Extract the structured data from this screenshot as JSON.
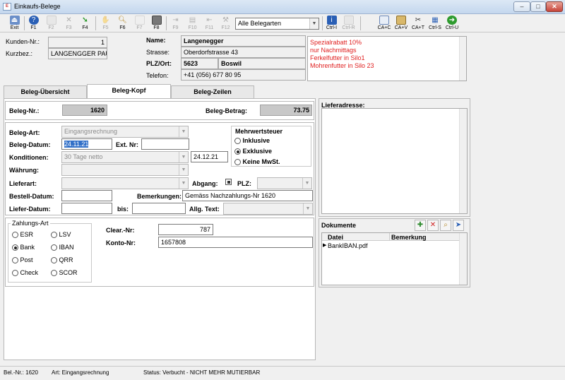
{
  "window": {
    "title": "Einkaufs-Belege",
    "minimize": "–",
    "maximize": "□",
    "close": "✕"
  },
  "toolbar": {
    "buttons": [
      {
        "label": "Exit"
      },
      {
        "label": "F1"
      },
      {
        "label": "F2"
      },
      {
        "label": "F3"
      },
      {
        "label": "F4"
      },
      {
        "label": "F5"
      },
      {
        "label": "F6"
      },
      {
        "label": "F7"
      },
      {
        "label": "F8"
      },
      {
        "label": "F9"
      },
      {
        "label": "F10"
      },
      {
        "label": "F11"
      },
      {
        "label": "F12"
      },
      {
        "label": "Ctrl-I"
      },
      {
        "label": "Ctrl-R"
      },
      {
        "label": "CA+C"
      },
      {
        "label": "CA+V"
      },
      {
        "label": "CA+T"
      },
      {
        "label": "Ctrl-S"
      },
      {
        "label": "Ctrl-U"
      }
    ],
    "belegarten_select": "Alle Belegarten"
  },
  "header": {
    "kunden_nr_label": "Kunden-Nr.:",
    "kunden_nr": "1",
    "kurzbez_label": "Kurzbez.:",
    "kurzbez": "LANGENGGER PAU",
    "name_label": "Name:",
    "name": "Langenegger",
    "strasse_label": "Strasse:",
    "strasse": "Oberdorfstrasse 43",
    "plz_ort_label": "PLZ/Ort:",
    "plz": "5623",
    "ort": "Boswil",
    "telefon_label": "Telefon:",
    "telefon": "+41 (056) 677 80 95",
    "notes": [
      "Spezialrabatt 10%",
      "nur Nachmittags",
      "Ferkelfutter in Silo1",
      "Mohrenfutter in Silo 23"
    ],
    "note_color": "#e02020"
  },
  "tabs": [
    {
      "label": "Beleg-Übersicht"
    },
    {
      "label": "Beleg-Kopf"
    },
    {
      "label": "Beleg-Zeilen"
    }
  ],
  "form": {
    "beleg_nr_label": "Beleg-Nr.:",
    "beleg_nr": "1620",
    "beleg_betrag_label": "Beleg-Betrag:",
    "beleg_betrag": "73.75",
    "beleg_art_label": "Beleg-Art:",
    "beleg_art": "Eingangsrechnung",
    "beleg_datum_label": "Beleg-Datum:",
    "beleg_datum": "24.11.21",
    "ext_nr_label": "Ext. Nr:",
    "ext_nr": "",
    "konditionen_label": "Konditionen:",
    "konditionen": "30 Tage netto",
    "konditionen_datum": "24.12.21",
    "waehrung_label": "Währung:",
    "waehrung": "",
    "lieferart_label": "Lieferart:",
    "lieferart": "",
    "abgang_label": "Abgang:",
    "plz_label": "PLZ:",
    "plz_value": "",
    "bestell_datum_label": "Bestell-Datum:",
    "bestell_datum": "",
    "bemerkungen_label": "Bemerkungen:",
    "bemerkungen": "Gemäss Nachzahlungs-Nr 1620",
    "liefer_datum_label": "Liefer-Datum:",
    "liefer_datum": "",
    "bis_label": "bis:",
    "bis": "",
    "allg_text_label": "Allg. Text:",
    "allg_text": "",
    "mwst": {
      "title": "Mehrwertsteuer",
      "options": [
        "Inklusive",
        "Exklusive",
        "Keine MwSt."
      ],
      "selected": "Exklusive"
    }
  },
  "zahlung": {
    "title": "Zahlungs-Art",
    "options": [
      "ESR",
      "LSV",
      "Bank",
      "IBAN",
      "Post",
      "QRR",
      "Check",
      "SCOR"
    ],
    "selected": "Bank",
    "clear_nr_label": "Clear.-Nr:",
    "clear_nr": "787",
    "konto_nr_label": "Konto-Nr:",
    "konto_nr": "1657808"
  },
  "lieferadresse": {
    "label": "Lieferadresse:"
  },
  "dokumente": {
    "title": "Dokumente",
    "columns": [
      "Datei",
      "Bemerkung"
    ],
    "rows": [
      {
        "datei": "BankIBAN.pdf",
        "bemerkung": ""
      }
    ]
  },
  "status": {
    "bel_nr": "Bel.-Nr.: 1620",
    "art": "Art: Eingangsrechnung",
    "status": "Status: Verbucht - NICHT MEHR MUTIERBAR"
  }
}
